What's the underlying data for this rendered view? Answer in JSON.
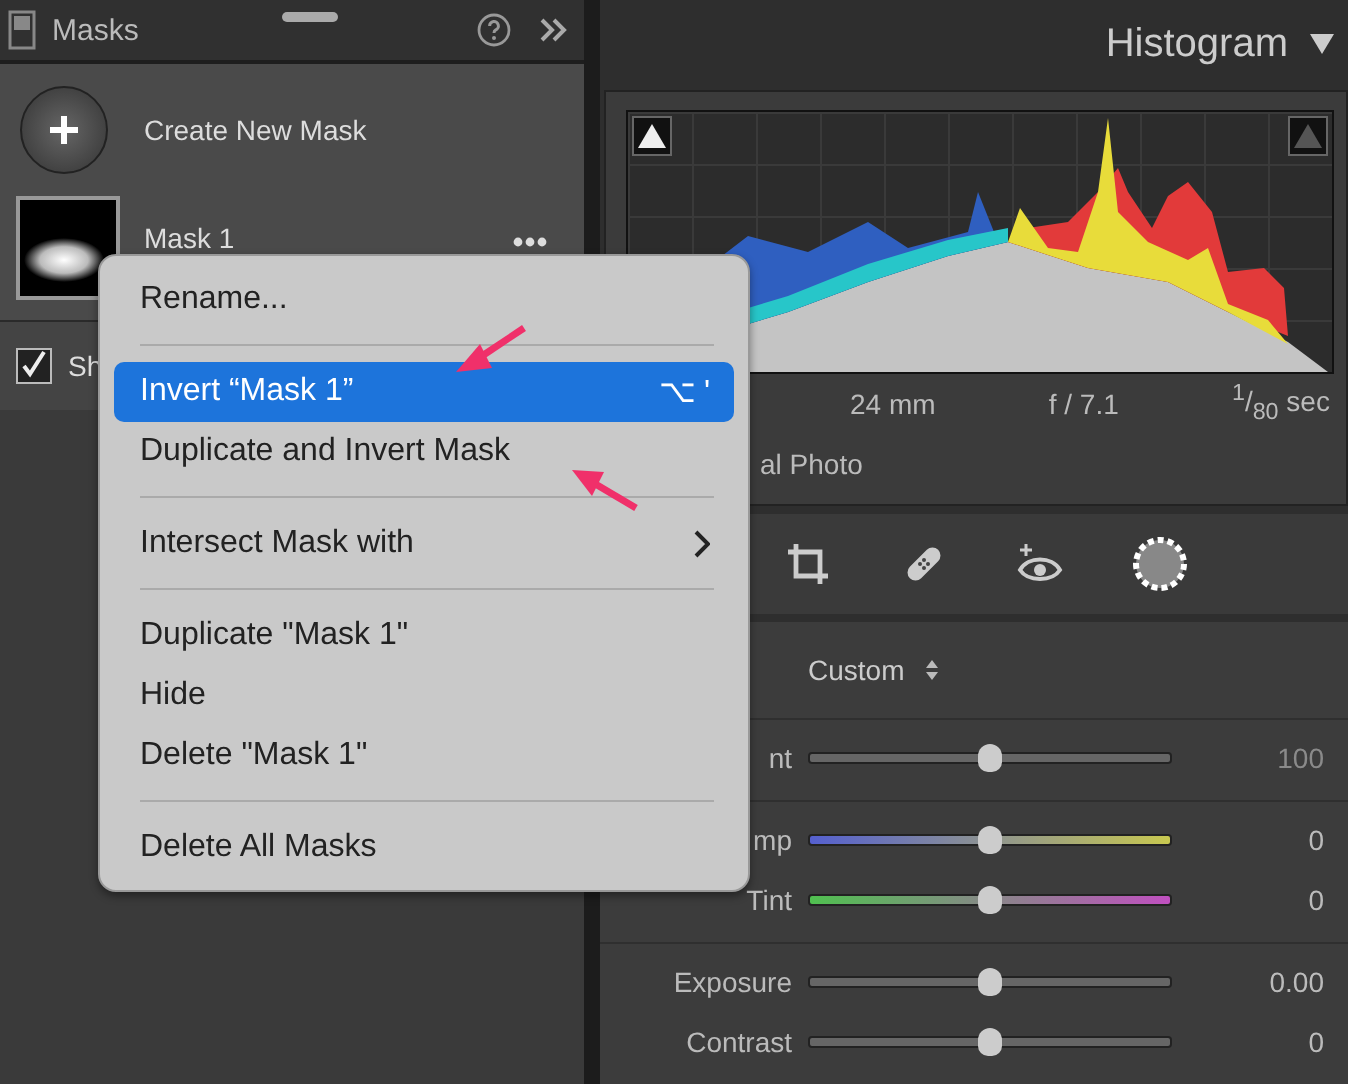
{
  "masks_panel": {
    "title": "Masks",
    "create_label": "Create New Mask",
    "mask": {
      "name": "Mask 1"
    },
    "overlay_option": {
      "label": "Sh",
      "checked": true
    }
  },
  "histogram": {
    "title": "Histogram",
    "info": [
      "24 mm",
      "f / 7.1",
      "$^{1}$/$_{80}$ sec"
    ],
    "photo_label": "al Photo"
  },
  "profile": {
    "value": "Custom"
  },
  "slider_groups": [
    {
      "sliders": [
        {
          "label": "nt",
          "kind": "plain",
          "level": 0.5,
          "reading": "100",
          "disabled": true
        }
      ]
    },
    {
      "sliders": [
        {
          "label": "mp",
          "kind": "temp",
          "level": 0.5,
          "reading": "0",
          "disabled": false
        },
        {
          "label": "Tint",
          "kind": "tint",
          "level": 0.5,
          "reading": "0",
          "disabled": false
        }
      ]
    },
    {
      "sliders": [
        {
          "label": "Exposure",
          "kind": "plain",
          "level": 0.5,
          "reading": "0.00",
          "disabled": false
        },
        {
          "label": "Contrast",
          "kind": "plain",
          "level": 0.5,
          "reading": "0",
          "disabled": false
        }
      ]
    }
  ],
  "context_menu": {
    "items": [
      {
        "kind": "item",
        "label": "Rename...",
        "selected": false
      },
      {
        "kind": "separator"
      },
      {
        "kind": "item",
        "label": "Invert “Mask 1”",
        "shortcut": "⌥ '",
        "selected": true
      },
      {
        "kind": "item",
        "label": "Duplicate and Invert Mask",
        "selected": false
      },
      {
        "kind": "separator"
      },
      {
        "kind": "submenu",
        "label": "Intersect Mask with",
        "selected": false
      },
      {
        "kind": "separator"
      },
      {
        "kind": "item",
        "label": "Duplicate \"Mask 1\"",
        "selected": false
      },
      {
        "kind": "item",
        "label": "Hide",
        "selected": false
      },
      {
        "kind": "item",
        "label": "Delete \"Mask 1\"",
        "selected": false
      },
      {
        "kind": "separator"
      },
      {
        "kind": "item",
        "label": "Delete All Masks",
        "selected": false
      }
    ]
  }
}
